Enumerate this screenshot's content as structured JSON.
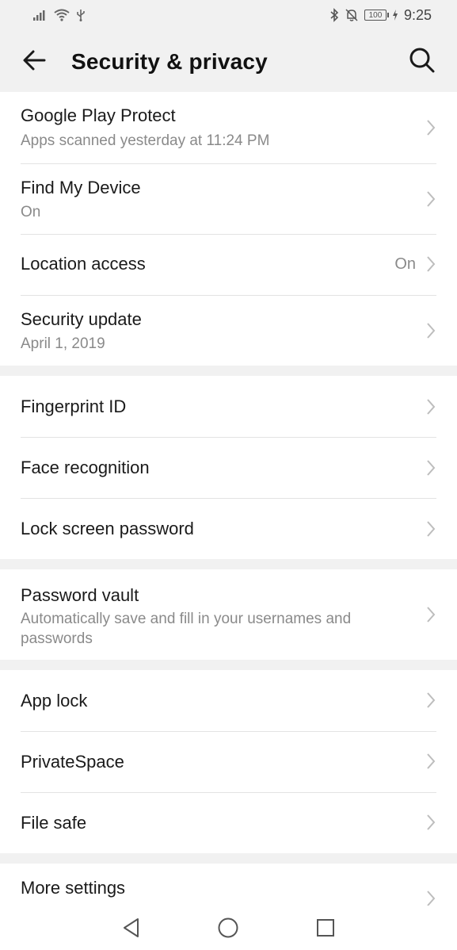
{
  "status_bar": {
    "time": "9:25",
    "battery": "100"
  },
  "header": {
    "title": "Security & privacy"
  },
  "groups": [
    {
      "items": [
        {
          "title": "Google Play Protect",
          "subtitle": "Apps scanned yesterday at 11:24 PM"
        },
        {
          "title": "Find My Device",
          "subtitle": "On"
        },
        {
          "title": "Location access",
          "value": "On"
        },
        {
          "title": "Security update",
          "subtitle": "April 1, 2019"
        }
      ]
    },
    {
      "items": [
        {
          "title": "Fingerprint ID"
        },
        {
          "title": "Face recognition"
        },
        {
          "title": "Lock screen password"
        }
      ]
    },
    {
      "items": [
        {
          "title": "Password vault",
          "subtitle": "Automatically save and fill in your usernames and passwords"
        }
      ]
    },
    {
      "items": [
        {
          "title": "App lock"
        },
        {
          "title": "PrivateSpace"
        },
        {
          "title": "File safe"
        }
      ]
    },
    {
      "items": [
        {
          "title": "More settings"
        }
      ]
    }
  ],
  "icons": {
    "back": "back-arrow-icon",
    "search": "search-icon",
    "chevron": "chevron-right-icon",
    "nav_back": "triangle-back-icon",
    "nav_home": "circle-home-icon",
    "nav_recents": "square-recents-icon"
  }
}
